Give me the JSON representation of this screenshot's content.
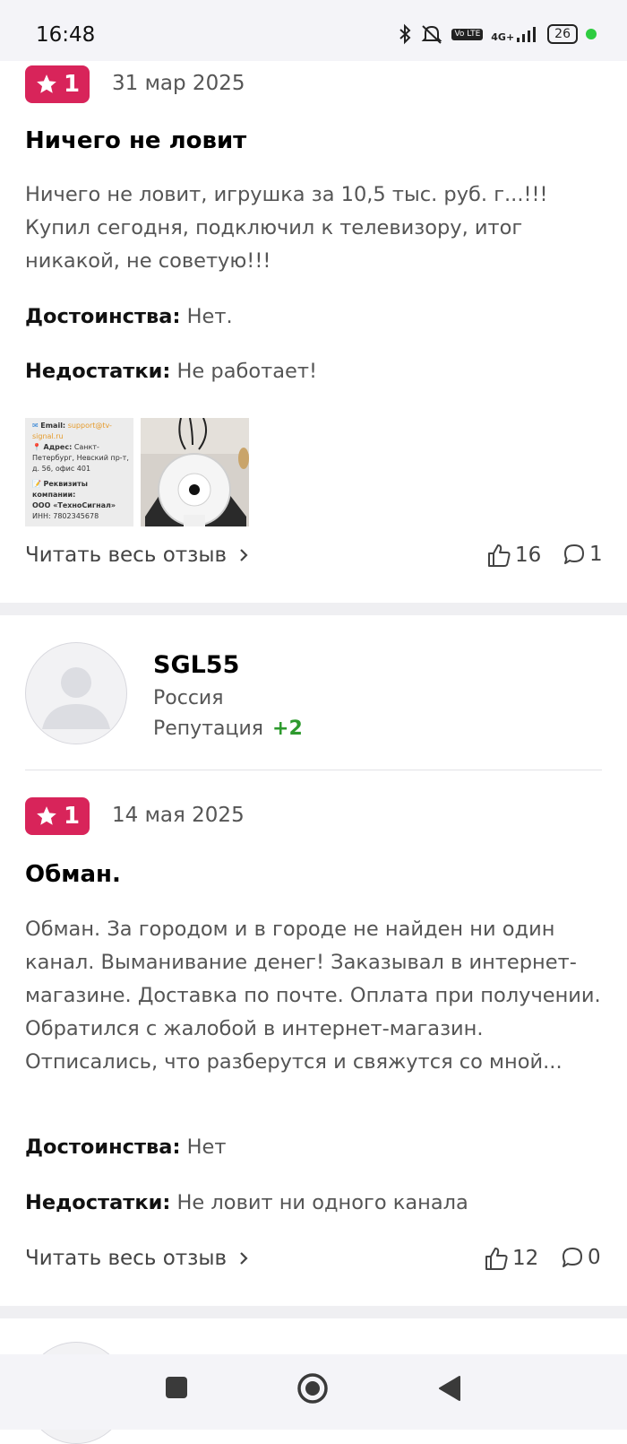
{
  "status_bar": {
    "time": "16:48",
    "network": "4G+",
    "volte": "Vo LTE",
    "battery": "26",
    "icons": [
      "bluetooth-icon",
      "mute-icon",
      "volte-icon",
      "signal-icon",
      "battery-icon",
      "dot-icon"
    ]
  },
  "reviews": [
    {
      "rating": "1",
      "date": "31 мар 2025",
      "title": "Ничего не ловит",
      "text": "Ничего не ловит, игрушка за 10,5 тыс. руб. г...!!! Купил сегодня, подключил к телевизору, итог никакой, не советую!!!",
      "pros_label": "Достоинства:",
      "pros": "Нет.",
      "cons_label": "Недостатки:",
      "cons": "Не работает!",
      "photo_text": {
        "email_label": "Email:",
        "email": "support@tv-signal.ru",
        "address_label": "Адрес:",
        "address": "Санкт-Петербург, Невский пр-т, д. 56, офис 401",
        "requisites_label": "Реквизиты компании:",
        "company": "ООО «ТехноСигнал»",
        "inn": "ИНН: 7802345678"
      },
      "read_more": "Читать весь отзыв",
      "likes": "16",
      "comments": "1"
    },
    {
      "user": {
        "name": "SGL55",
        "country": "Россия",
        "reputation_label": "Репутация",
        "reputation": "+2"
      },
      "rating": "1",
      "date": "14 мая 2025",
      "title": "Обман.",
      "text": "Обман. За городом и в городе не найден ни один канал. Выманивание денег! Заказывал в интернет-магазине. Доставка по почте. Оплата при получении. Обратился с жалобой в интернет-магазин. Отписались, что разберутся и свяжутся со мной...",
      "pros_label": "Достоинства:",
      "pros": "Нет",
      "cons_label": "Недостатки:",
      "cons": "Не ловит ни одного канала",
      "read_more": "Читать весь отзыв",
      "likes": "12",
      "comments": "0"
    }
  ],
  "colors": {
    "rating_badge": "#d8245a",
    "reputation_positive": "#2e9a2e"
  }
}
